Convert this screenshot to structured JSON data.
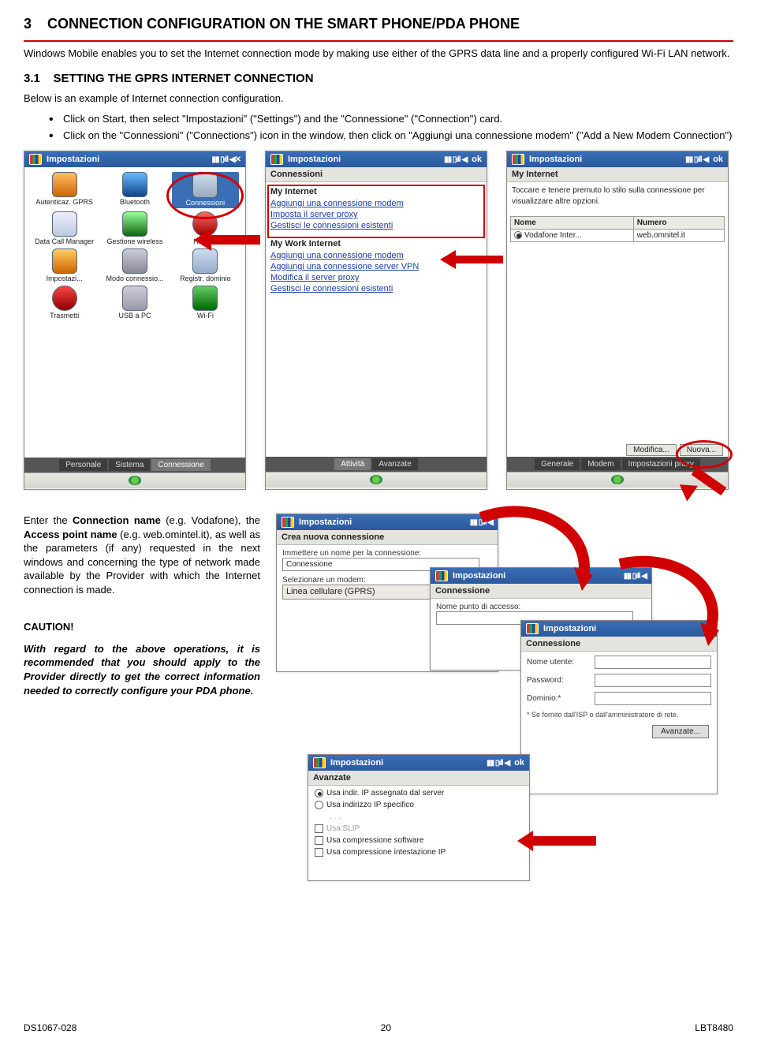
{
  "section": {
    "num": "3",
    "title": "CONNECTION CONFIGURATION ON THE SMART PHONE/PDA PHONE"
  },
  "intro": "Windows Mobile enables you to set the Internet connection mode by making use either of the GPRS data line and a properly configured Wi-Fi LAN network.",
  "sub": {
    "num": "3.1",
    "title": "SETTING THE GPRS INTERNET CONNECTION"
  },
  "sub_intro": "Below is an example of Internet connection configuration.",
  "bullets": [
    "Click on Start, then select \"Impostazioni\" (\"Settings\") and the \"Connessione\" (\"Connection\") card.",
    "Click on the \"Connessioni\" (\"Connections\") icon in the window, then click on \"Aggiungi una connessione modem\" (\"Add a New Modem Connection\")"
  ],
  "phone1": {
    "title": "Impostazioni",
    "icons": [
      {
        "label": "Autenticaz. GPRS"
      },
      {
        "label": "Bluetooth"
      },
      {
        "label": "Connessioni",
        "selected": true
      },
      {
        "label": "Data Call Manager"
      },
      {
        "label": "Gestione wireless"
      },
      {
        "label": "HSDPA"
      },
      {
        "label": "Impostazi..."
      },
      {
        "label": "Modo connessio..."
      },
      {
        "label": "Registr. dominio"
      },
      {
        "label": "Trasmetti"
      },
      {
        "label": "USB a PC"
      },
      {
        "label": "Wi-Fi"
      }
    ],
    "tabs": [
      "Personale",
      "Sistema",
      "Connessione"
    ],
    "activeTab": 2
  },
  "phone2": {
    "title": "Impostazioni",
    "sub": "Connessioni",
    "sec1": "My Internet",
    "links1": [
      "Aggiungi una connessione modem",
      "Imposta il server proxy",
      "Gestisci le connessioni esistenti"
    ],
    "sec2": "My Work Internet",
    "links2": [
      "Aggiungi una connessione modem",
      "Aggiungi una connessione server VPN",
      "Modifica il server proxy",
      "Gestisci le connessioni esistenti"
    ],
    "tabs": [
      "Attività",
      "Avanzate"
    ],
    "ok": "ok"
  },
  "phone3": {
    "title": "Impostazioni",
    "sub": "My Internet",
    "hint": "Toccare e tenere premuto lo stilo sulla connessione per visualizzare altre opzioni.",
    "col_name": "Nome",
    "col_num": "Numero",
    "row_name": "Vodafone Inter...",
    "row_num": "web.omnitel.it",
    "btn_mod": "Modifica...",
    "btn_new": "Nuova...",
    "tabs": [
      "Generale",
      "Modem",
      "Impostazioni proxy"
    ],
    "ok": "ok"
  },
  "lower_para": "Enter the Connection name (e.g. Vodafone), the Access point name (e.g. web.omintel.it), as well as the parameters (if any) requested in the next windows and concerning the type of network made available by the Provider with which the Internet connection is made.",
  "caution_h": "CAUTION!",
  "caution_b": "With regard to the above operations, it is recommended that you should apply to the Provider directly to get the correct information needed to correctly configure your PDA phone.",
  "phone4": {
    "title": "Impostazioni",
    "sub": "Crea nuova connessione",
    "l1": "Immettere un nome per la connessione:",
    "v1": "Connessione",
    "l2": "Selezionare un modem:",
    "v2": "Linea cellulare (GPRS)"
  },
  "phone5": {
    "title": "Impostazioni",
    "sub": "Connessione",
    "l1": "Nome punto di accesso:"
  },
  "phone6": {
    "title": "Impostazioni",
    "sub": "Connessione",
    "l_user": "Nome utente:",
    "l_pass": "Password:",
    "l_dom": "Dominio:*",
    "note": "* Se fornito dall'ISP o dall'amministratore di rete.",
    "btn_adv": "Avanzate..."
  },
  "phone7": {
    "title": "Impostazioni",
    "sub": "Avanzate",
    "o1": "Usa indir. IP assegnato dal server",
    "o2": "Usa indirizzo IP specifico",
    "c1": "Usa SLIP",
    "c2": "Usa compressione software",
    "c3": "Usa compressione intestazione IP",
    "ok": "ok"
  },
  "footer": {
    "left": "DS1067-028",
    "center": "20",
    "right": "LBT8480"
  }
}
